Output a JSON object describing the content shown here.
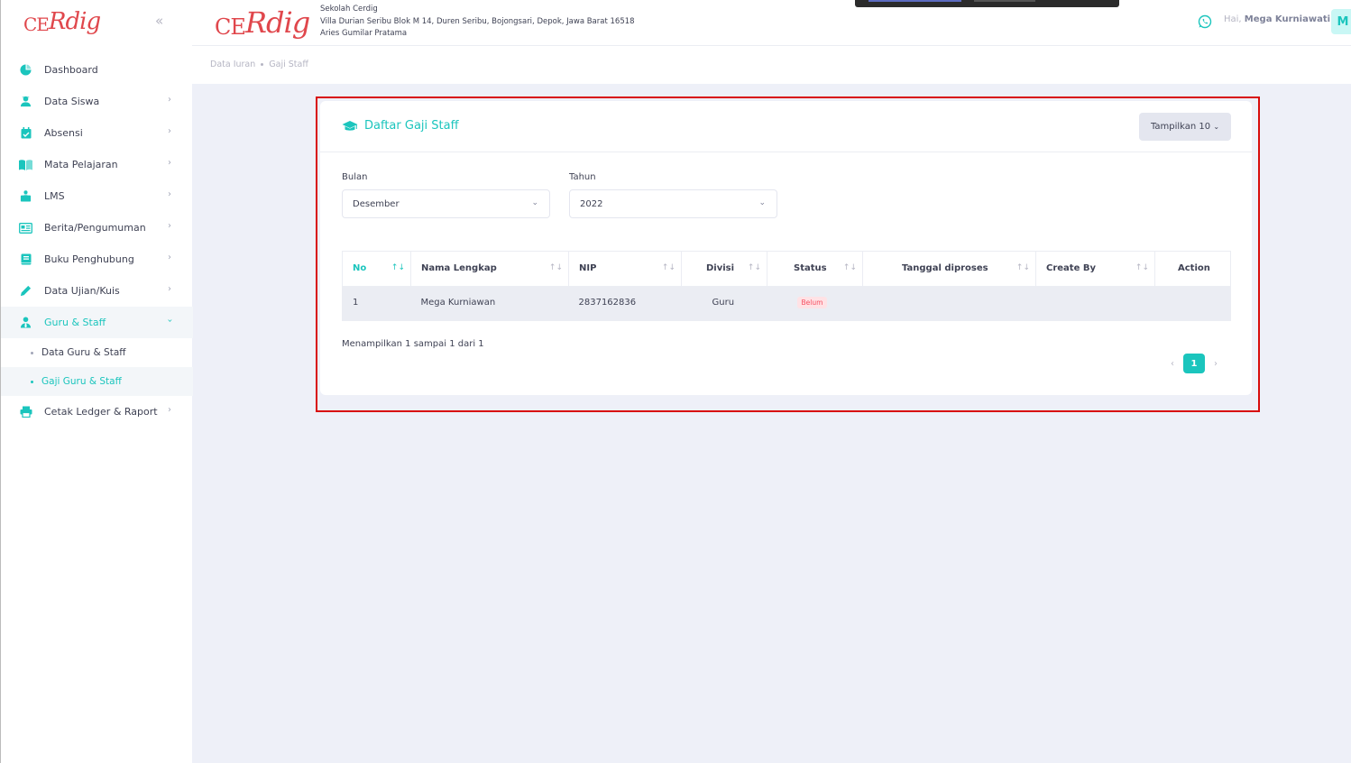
{
  "brand": {
    "logo_text_1": "CE",
    "logo_text_2": "Rdig"
  },
  "header": {
    "school_name": "Sekolah Cerdig",
    "school_address": "Villa Durian Seribu Blok M 14, Duren Seribu, Bojongsari, Depok, Jawa Barat 16518",
    "school_head": "Aries Gumilar Pratama",
    "greeting": "Hai,",
    "user_name": "Mega Kurniawati",
    "avatar_initial": "M"
  },
  "sidebar": {
    "items": [
      {
        "label": "Dashboard",
        "icon": "dashboard-icon"
      },
      {
        "label": "Data Siswa",
        "icon": "student-icon"
      },
      {
        "label": "Absensi",
        "icon": "calendar-check-icon"
      },
      {
        "label": "Mata Pelajaran",
        "icon": "book-icon"
      },
      {
        "label": "LMS",
        "icon": "classroom-icon"
      },
      {
        "label": "Berita/Pengumuman",
        "icon": "newspaper-icon"
      },
      {
        "label": "Buku Penghubung",
        "icon": "notebook-icon"
      },
      {
        "label": "Data Ujian/Kuis",
        "icon": "pencil-icon"
      },
      {
        "label": "Guru & Staff",
        "icon": "user-tie-icon"
      },
      {
        "label": "Cetak Ledger & Raport",
        "icon": "printer-icon"
      }
    ],
    "subitems": [
      {
        "label": "Data Guru & Staff"
      },
      {
        "label": "Gaji Guru & Staff"
      }
    ]
  },
  "breadcrumb": {
    "items": [
      "Data Iuran",
      "Gaji Staff"
    ]
  },
  "card": {
    "title": "Daftar Gaji Staff",
    "page_size_label": "Tampilkan 10",
    "filters": {
      "month_label": "Bulan",
      "month_value": "Desember",
      "year_label": "Tahun",
      "year_value": "2022"
    },
    "table": {
      "columns": [
        "No",
        "Nama Lengkap",
        "NIP",
        "Divisi",
        "Status",
        "Tanggal diproses",
        "Create By",
        "Action"
      ],
      "rows": [
        {
          "no": "1",
          "name": "Mega Kurniawan",
          "nip": "2837162836",
          "divisi": "Guru",
          "status": "Belum",
          "tanggal": "",
          "create_by": "",
          "action": ""
        }
      ]
    },
    "info": "Menampilkan 1 sampai 1 dari 1",
    "pagination": {
      "prev": "‹",
      "current": "1",
      "next": "›"
    }
  },
  "colors": {
    "accent": "#1bc5bd",
    "brand_red": "#e0474c",
    "highlight_border": "#d80b0b",
    "badge_danger": "#f64e60"
  }
}
